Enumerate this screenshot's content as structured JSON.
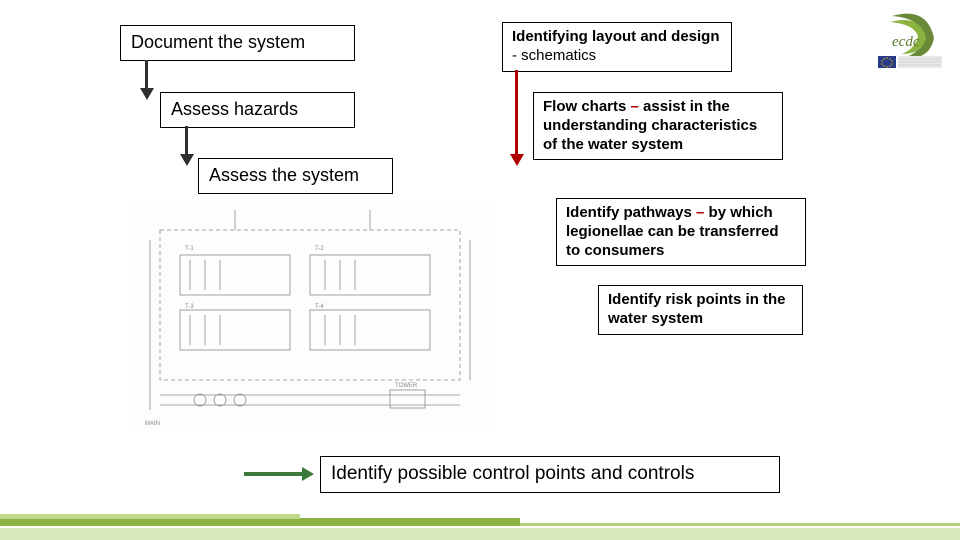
{
  "left": {
    "step1": "Document the system",
    "step2": "Assess hazards",
    "step3": "Assess the system"
  },
  "right": {
    "box1": {
      "bold": "Identifying layout and design",
      "rest": " - schematics"
    },
    "box2": {
      "lead": "Flow charts",
      "dash": " – ",
      "rest": "assist in the understanding characteristics of the water system"
    },
    "box3": {
      "lead": "Identify pathways",
      "dash": " – ",
      "rest": "by which legionellae can be transferred to consumers"
    },
    "box4": {
      "lead": "Identify risk points",
      "rest": " in the water system"
    }
  },
  "bottom": "Identify possible control points and controls",
  "colors": {
    "dark_arrow": "#2f2f2f",
    "red_arrow": "#b00000",
    "green_arrow": "#3b7a3b",
    "green_band": "#8ab43f"
  },
  "logo_text": "ecdc"
}
